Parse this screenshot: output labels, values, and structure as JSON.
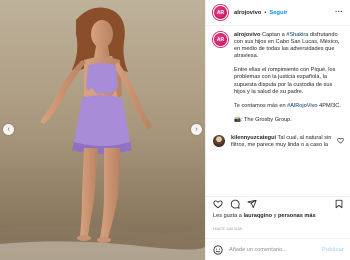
{
  "post": {
    "username": "alrojovivo",
    "follow_label": "Seguir",
    "avatar_initials": "AR",
    "caption": {
      "author": "alrojovivo",
      "line1_pre": " Captan a ",
      "mention": "#Shakira",
      "line1_post": " disfrutando con sus hijos en Cabo San Lucas, México, en medio de todas las adversidades que atraviesa.",
      "para2": "Entre ellas el rompimiento con Piqué, los problemas con la justicia española, la supuesta disputa por la custodia de sus hijos y la salud de su padre.",
      "para3_pre": "Te contamos más en ",
      "para3_tag": "#AlRojoVivo",
      "para3_post": " 4PM/3C.",
      "para4": "📸: The Grosby Group."
    },
    "comment": {
      "author": "kilennyuzcategui",
      "text": " Tal cual, al natural sin filtros, me parece muy linda o a caso la gente ya a la ideya"
    },
    "likes": {
      "prefix": "Les gusta a ",
      "user": "lauraqgino",
      "middle": " y ",
      "others": "personas más"
    },
    "date": "HACE UN DÍA",
    "add_comment_placeholder": "Añade un comentario...",
    "publish_label": "Publicar"
  },
  "icons": {
    "more": "more-options-icon",
    "heart": "heart-icon",
    "comment": "comment-icon",
    "share": "share-icon",
    "bookmark": "bookmark-icon",
    "emoji": "emoji-icon",
    "prev": "chevron-left-icon",
    "next": "chevron-right-icon"
  },
  "colors": {
    "accent": "#0095f6",
    "brand": "#e1306c",
    "dress": "#a98cd8"
  }
}
